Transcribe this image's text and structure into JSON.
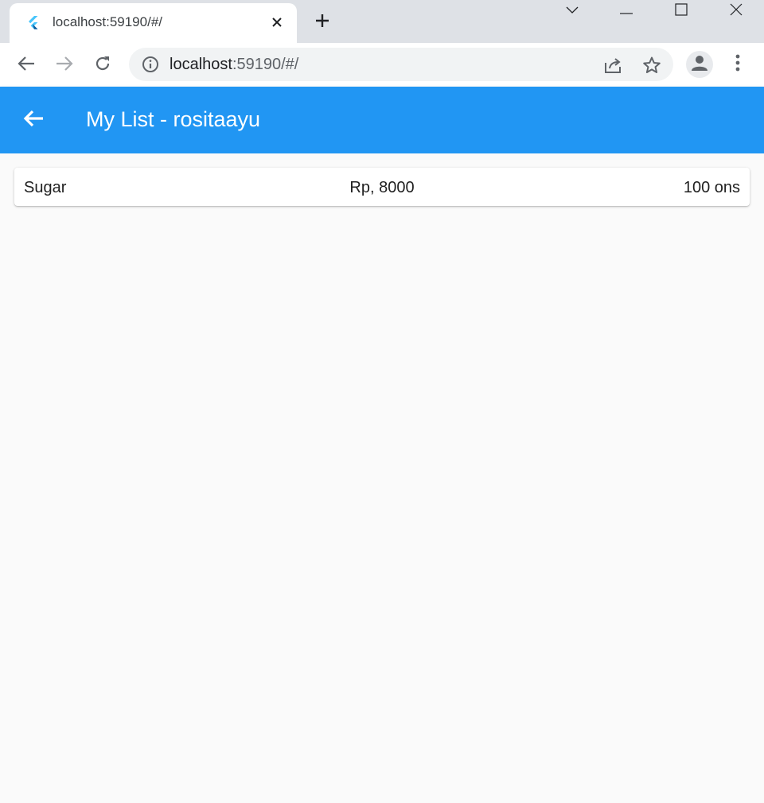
{
  "browser": {
    "tab": {
      "title": "localhost:59190/#/",
      "favicon_icon": "flutter-logo-icon",
      "close_icon": "close-icon"
    },
    "new_tab_icon": "plus-icon",
    "window_controls": [
      "chevron-down-icon",
      "minimize-icon",
      "maximize-icon",
      "close-icon"
    ],
    "toolbar": {
      "back_icon": "arrow-left-icon",
      "forward_icon": "arrow-right-icon",
      "reload_icon": "reload-icon",
      "url_host": "localhost",
      "url_rest": ":59190/#/",
      "info_icon": "info-icon",
      "share_icon": "share-icon",
      "bookmark_icon": "star-icon",
      "profile_icon": "person-icon",
      "menu_icon": "kebab-menu-icon"
    }
  },
  "app": {
    "appbar": {
      "back_icon": "arrow-left-icon",
      "title": "My List - rositaayu",
      "color": "#2196f3"
    },
    "items": [
      {
        "name": "Sugar",
        "price": "Rp, 8000",
        "quantity": "100 ons"
      }
    ]
  }
}
